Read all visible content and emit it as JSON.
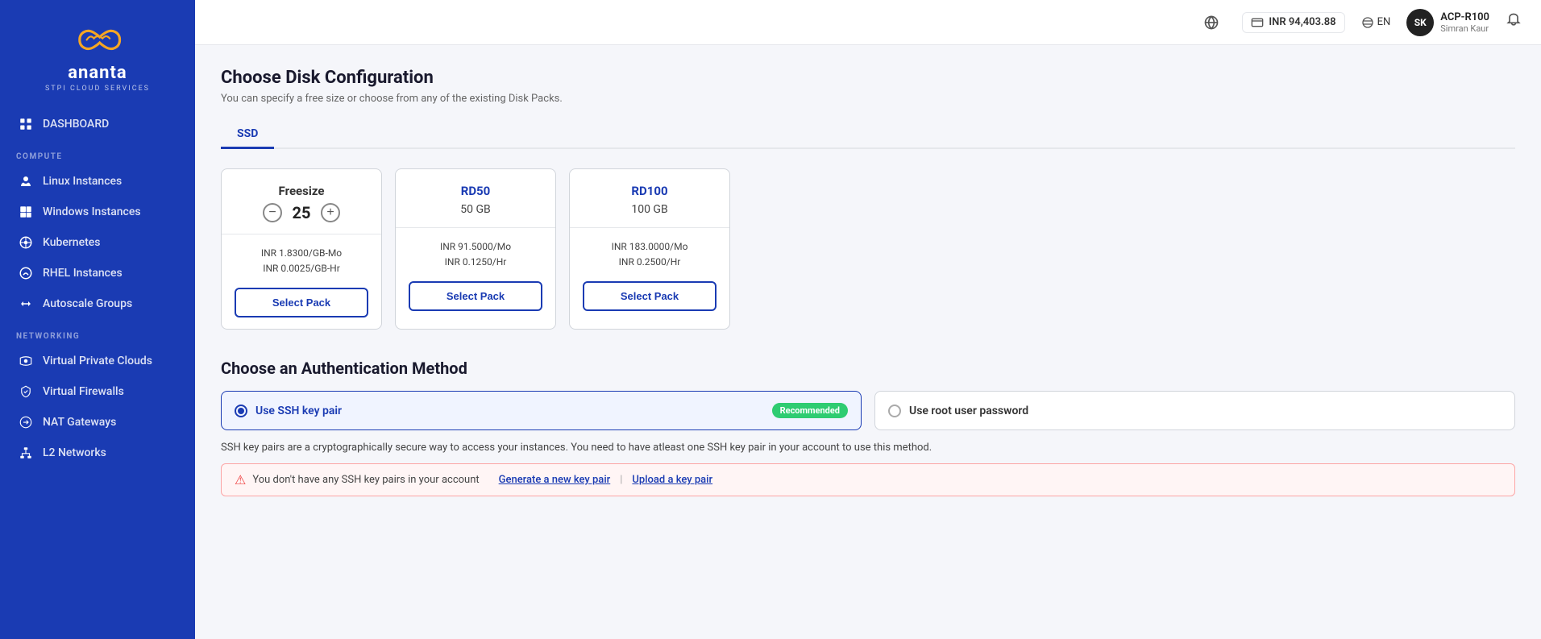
{
  "sidebar": {
    "logo_text": "ananta",
    "logo_subtext": "STPI CLOUD SERVICES",
    "sections": [
      {
        "label": "DASHBOARD",
        "items": []
      },
      {
        "label": "COMPUTE",
        "items": [
          {
            "id": "linux-instances",
            "label": "Linux Instances",
            "icon": "linux"
          },
          {
            "id": "windows-instances",
            "label": "Windows Instances",
            "icon": "windows",
            "active": true
          },
          {
            "id": "kubernetes",
            "label": "Kubernetes",
            "icon": "kubernetes"
          },
          {
            "id": "rhel-instances",
            "label": "RHEL Instances",
            "icon": "rhel"
          },
          {
            "id": "autoscale-groups",
            "label": "Autoscale Groups",
            "icon": "autoscale"
          }
        ]
      },
      {
        "label": "NETWORKING",
        "items": [
          {
            "id": "virtual-private-clouds",
            "label": "Virtual Private Clouds",
            "icon": "vpc"
          },
          {
            "id": "virtual-firewalls",
            "label": "Virtual Firewalls",
            "icon": "firewall"
          },
          {
            "id": "nat-gateways",
            "label": "NAT Gateways",
            "icon": "nat"
          },
          {
            "id": "l2-networks",
            "label": "L2 Networks",
            "icon": "l2"
          }
        ]
      }
    ],
    "dashboard_label": "DASHBOARD"
  },
  "header": {
    "balance_label": "INR 94,403.88",
    "lang_label": "EN",
    "user_initials": "SK",
    "user_name": "ACP-R100",
    "user_sub": "Simran Kaur"
  },
  "main": {
    "page_title": "Choose Disk Configuration",
    "page_subtitle": "You can specify a free size or choose from any of the existing Disk Packs.",
    "tabs": [
      {
        "id": "ssd",
        "label": "SSD",
        "active": true
      }
    ],
    "disk_packs": [
      {
        "id": "freesize",
        "name": "Freesize",
        "type": "freesize",
        "value": 25,
        "price1": "INR 1.8300/GB-Mo",
        "price2": "INR 0.0025/GB-Hr",
        "btn_label": "Select Pack"
      },
      {
        "id": "rd50",
        "name": "RD50",
        "type": "pack",
        "size": "50 GB",
        "price1": "INR 91.5000/Mo",
        "price2": "INR 0.1250/Hr",
        "btn_label": "Select Pack"
      },
      {
        "id": "rd100",
        "name": "RD100",
        "type": "pack",
        "size": "100 GB",
        "price1": "INR 183.0000/Mo",
        "price2": "INR 0.2500/Hr",
        "btn_label": "Select Pack"
      }
    ],
    "auth_section": {
      "title": "Choose an Authentication Method",
      "options": [
        {
          "id": "ssh",
          "label": "Use SSH key pair",
          "selected": true,
          "recommended": true,
          "recommended_label": "Recommended"
        },
        {
          "id": "password",
          "label": "Use root user password",
          "selected": false,
          "recommended": false
        }
      ],
      "description": "SSH key pairs are a cryptographically secure way to access your instances. You need to have atleast one SSH key pair in your account to use this method.",
      "warning_text": "You don't have any SSH key pairs in your account",
      "generate_link": "Generate a new key pair",
      "upload_link": "Upload a key pair"
    }
  }
}
